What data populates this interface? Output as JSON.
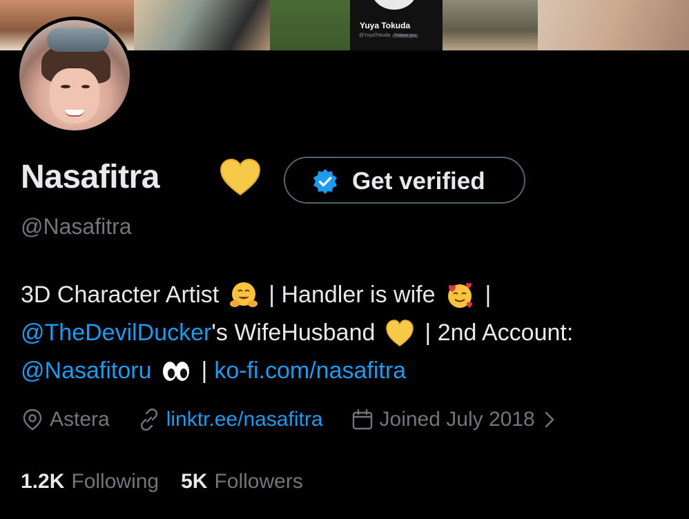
{
  "banner": {
    "shown_name": "Yuya Tokuda",
    "shown_handle": "@YuyaTokuda",
    "shown_badge": "Follows you"
  },
  "profile": {
    "display_name": "Nasafitra",
    "handle": "@Nasafitra",
    "verify_label": "Get verified"
  },
  "bio": {
    "line1_a": "3D Character Artist",
    "line1_b": "| Handler is wife",
    "line1_c": "|",
    "line2_link": "@TheDevilDucker",
    "line2_a": "'s WifeHusband",
    "line2_b": "| 2nd Account:",
    "line3_link1": "@Nasafitoru",
    "line3_sep": "|",
    "line3_link2": "ko-fi.com/nasafitra"
  },
  "meta": {
    "location": "Astera",
    "website": "linktr.ee/nasafitra",
    "joined": "Joined July 2018"
  },
  "stats": {
    "following_count": "1.2K",
    "following_label": "Following",
    "followers_count": "5K",
    "followers_label": "Followers"
  },
  "colors": {
    "link": "#1d9bf0",
    "secondary_text": "#71767b",
    "primary_text": "#e7e9ea",
    "background": "#000000"
  },
  "icons": [
    "yellow-heart-icon",
    "verified-badge-icon",
    "hugging-face-icon",
    "smiling-hearts-face-icon",
    "eyes-icon",
    "location-pin-icon",
    "link-icon",
    "calendar-icon",
    "chevron-right-icon"
  ]
}
